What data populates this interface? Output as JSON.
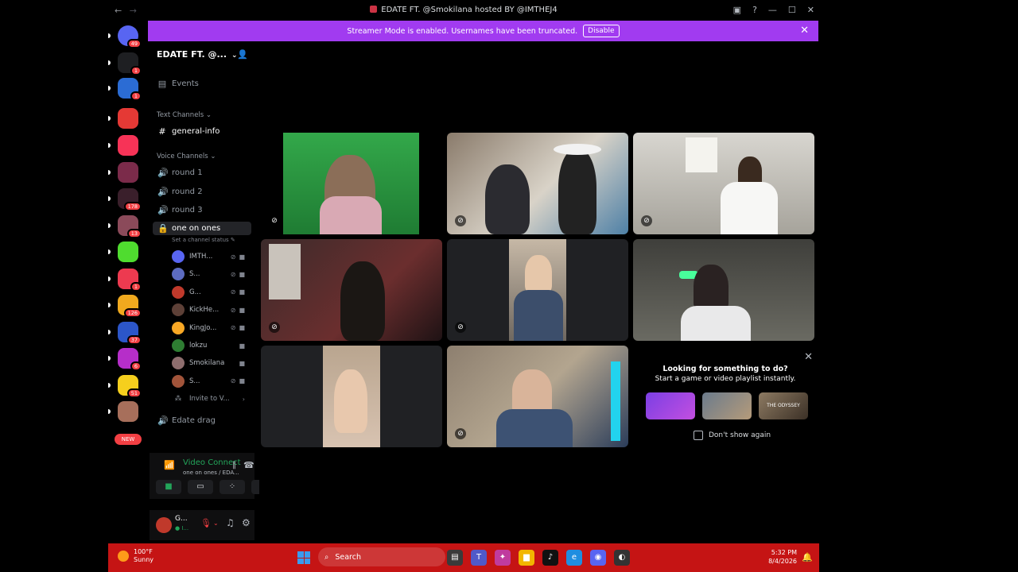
{
  "window": {
    "title": "EDATE FT. @Smokilana hosted BY @IMTHEJ4",
    "nav_back": "←",
    "nav_forward": "→"
  },
  "banner": {
    "text": "Streamer Mode is enabled. Usernames have been truncated.",
    "disable_label": "Disable",
    "close": "✕"
  },
  "servers": [
    {
      "badge": "49",
      "color": "#5865f2"
    },
    {
      "badge": "1",
      "color": "#1e1f22"
    },
    {
      "badge": "1",
      "color": "#2b6cd4"
    },
    {
      "badge": "",
      "color": "#e53935"
    },
    {
      "badge": "",
      "color": "#f73357"
    },
    {
      "badge": "",
      "color": "#7b2b4a"
    },
    {
      "badge": "178",
      "color": "#3a1f2b"
    },
    {
      "badge": "13",
      "color": "#8b4a5a"
    },
    {
      "badge": "",
      "color": "#4fdc2f"
    },
    {
      "badge": "1",
      "color": "#ed3a50"
    },
    {
      "badge": "126",
      "color": "#f0a91e"
    },
    {
      "badge": "37",
      "color": "#2c56c9"
    },
    {
      "badge": "6",
      "color": "#b62ec9"
    },
    {
      "badge": "51",
      "color": "#f5cf1d"
    },
    {
      "badge": "",
      "color": "#a76f5b"
    }
  ],
  "new_badge": "NEW",
  "guild": {
    "name": "EDATE FT. @...",
    "events_label": "Events",
    "text_category": "Text Channels",
    "text_channel": "general-info",
    "voice_category": "Voice Channels",
    "voice_channels": [
      "round 1",
      "round 2",
      "round 3"
    ],
    "active_channel": "one on ones",
    "channel_status": "Set a channel status",
    "users": [
      {
        "name": "IMTH...",
        "color": "#5865f2",
        "muted": true
      },
      {
        "name": "S...",
        "color": "#5c6bc0",
        "muted": true
      },
      {
        "name": "G...",
        "color": "#c0392b",
        "muted": true
      },
      {
        "name": "KickHe...",
        "color": "#5d4037",
        "muted": true
      },
      {
        "name": "KingJo...",
        "color": "#f9a825",
        "muted": true
      },
      {
        "name": "lokzu",
        "color": "#2e7d32",
        "muted": false
      },
      {
        "name": "Smokilana",
        "color": "#8e6e6e",
        "muted": false
      },
      {
        "name": "S...",
        "color": "#a1543a",
        "muted": true
      }
    ],
    "invite_label": "Invite to V...",
    "last_channel": "Edate drag"
  },
  "voice_panel": {
    "status": "Video Connect",
    "sub": "one on ones / EDA..."
  },
  "user_panel": {
    "name": "G...",
    "sub": "● I..."
  },
  "promo": {
    "title": "Looking for something to do?",
    "subtitle": "Start a game or video playlist instantly.",
    "thumbs": [
      "",
      "",
      "THE ODYSSEY"
    ],
    "dont_show": "Don't show again"
  },
  "taskbar": {
    "temp": "100°F",
    "weather": "Sunny",
    "search": "Search",
    "time": "5:32 PM",
    "date": "8/4/2026"
  }
}
